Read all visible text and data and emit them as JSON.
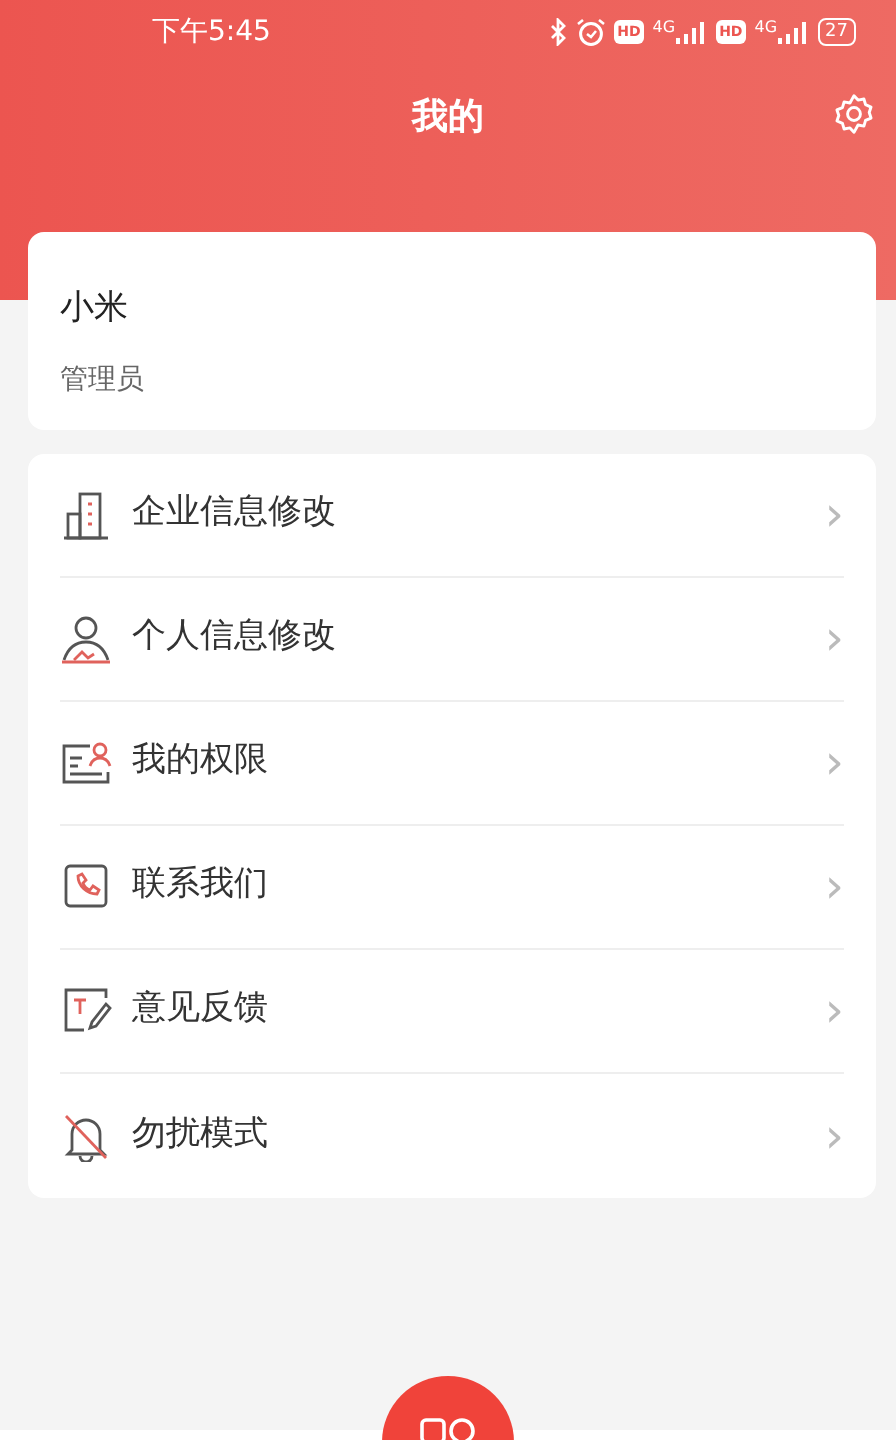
{
  "status_bar": {
    "time": "下午5:45",
    "sim1_hd": "HD",
    "sim1_network": "4G",
    "sim2_hd": "HD",
    "sim2_network": "4G",
    "battery": "27"
  },
  "header": {
    "title": "我的"
  },
  "profile": {
    "name": "小米",
    "role": "管理员"
  },
  "menu": [
    {
      "label": "企业信息修改",
      "chevron": "›"
    },
    {
      "label": "个人信息修改",
      "chevron": "›"
    },
    {
      "label": "我的权限",
      "chevron": "›"
    },
    {
      "label": "联系我们",
      "chevron": "›"
    },
    {
      "label": "意见反馈",
      "chevron": "›"
    },
    {
      "label": "勿扰模式",
      "chevron": "›"
    }
  ]
}
